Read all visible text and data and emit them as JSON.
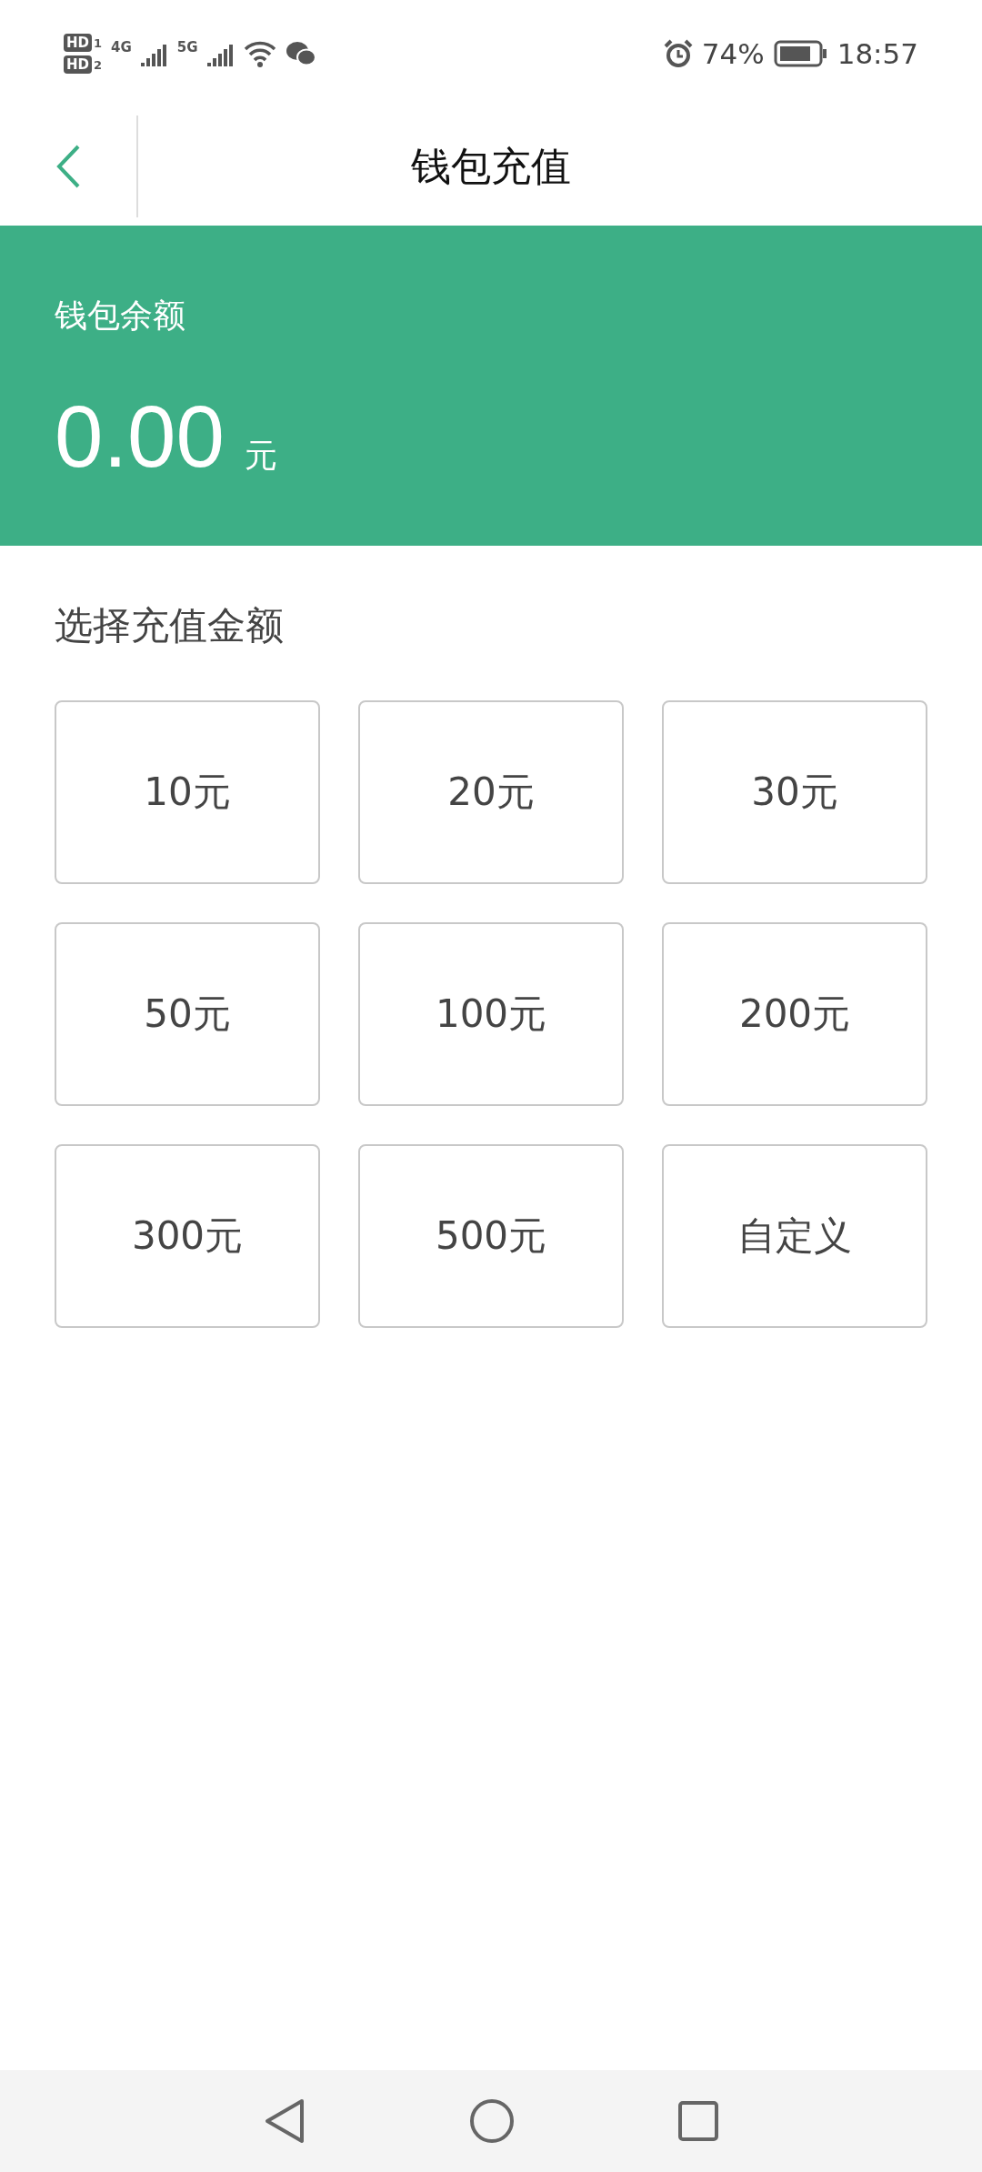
{
  "status_bar": {
    "sims": [
      {
        "label": "HD",
        "index": "1"
      },
      {
        "label": "HD",
        "index": "2"
      }
    ],
    "networks": [
      "4G",
      "5G"
    ],
    "battery_text": "74%",
    "time": "18:57"
  },
  "header": {
    "title": "钱包充值"
  },
  "balance": {
    "label": "钱包余额",
    "amount": "0.00",
    "unit": "元"
  },
  "section_title": "选择充值金额",
  "amounts": [
    {
      "label": "10元",
      "selected": false
    },
    {
      "label": "20元",
      "selected": false
    },
    {
      "label": "30元",
      "selected": false
    },
    {
      "label": "50元",
      "selected": false
    },
    {
      "label": "100元",
      "selected": false
    },
    {
      "label": "200元",
      "selected": false
    },
    {
      "label": "300元",
      "selected": false
    },
    {
      "label": "500元",
      "selected": false
    },
    {
      "label": "自定义",
      "selected": false
    }
  ]
}
